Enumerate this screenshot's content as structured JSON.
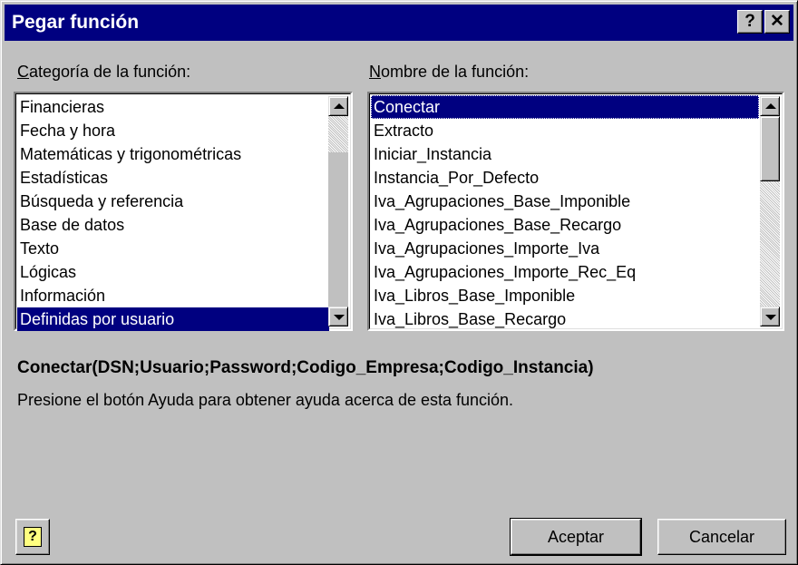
{
  "window": {
    "title": "Pegar función",
    "help_button": "?",
    "close_button": "✕"
  },
  "category": {
    "label_prefix": "C",
    "label_rest": "ategoría de la función:",
    "items": [
      "Financieras",
      "Fecha y hora",
      "Matemáticas y trigonométricas",
      "Estadísticas",
      "Búsqueda y referencia",
      "Base de datos",
      "Texto",
      "Lógicas",
      "Información",
      "Definidas por usuario"
    ],
    "selected": "Definidas por usuario"
  },
  "function": {
    "label_prefix": "N",
    "label_rest": "ombre de la función:",
    "items": [
      "Conectar",
      "Extracto",
      "Iniciar_Instancia",
      "Instancia_Por_Defecto",
      "Iva_Agrupaciones_Base_Imponible",
      "Iva_Agrupaciones_Base_Recargo",
      "Iva_Agrupaciones_Importe_Iva",
      "Iva_Agrupaciones_Importe_Rec_Eq",
      "Iva_Libros_Base_Imponible",
      "Iva_Libros_Base_Recargo"
    ],
    "selected": "Conectar"
  },
  "syntax": "Conectar(DSN;Usuario;Password;Codigo_Empresa;Codigo_Instancia)",
  "description": "Presione el botón Ayuda para obtener ayuda acerca de esta función.",
  "buttons": {
    "help_icon": "?",
    "ok": "Aceptar",
    "cancel": "Cancelar"
  },
  "colors": {
    "titlebar": "#000080",
    "selection": "#000080",
    "face": "#c0c0c0"
  }
}
